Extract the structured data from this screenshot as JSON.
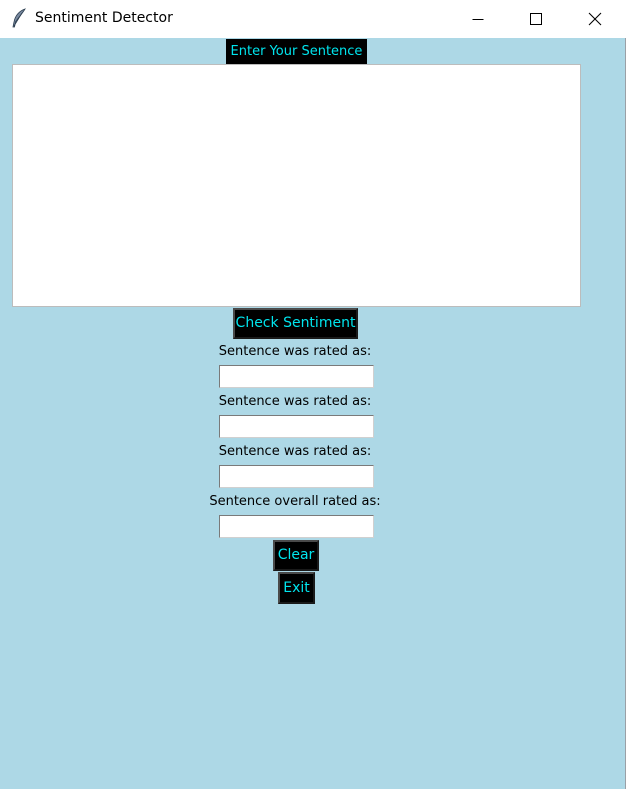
{
  "window": {
    "title": "Sentiment Detector",
    "icon": "feather-icon",
    "background_color": "#add8e6",
    "controls": [
      "minimize-icon",
      "maximize-icon",
      "close-icon"
    ]
  },
  "main": {
    "heading": "Enter Your Sentence",
    "sentence_input_value": "",
    "check_button_label": "Check Sentiment",
    "results": [
      {
        "label": "Sentence was rated as:",
        "value": ""
      },
      {
        "label": "Sentence was rated as:",
        "value": ""
      },
      {
        "label": "Sentence was rated as:",
        "value": ""
      },
      {
        "label": "Sentence overall rated as:",
        "value": ""
      }
    ],
    "clear_button_label": "Clear",
    "exit_button_label": "Exit",
    "button_bg_color": "#000000",
    "button_text_color": "#00e5ee"
  }
}
